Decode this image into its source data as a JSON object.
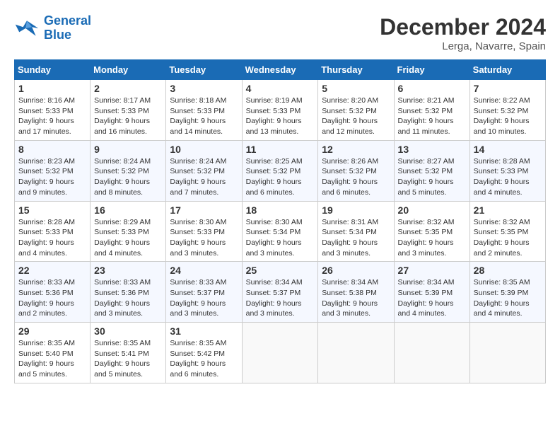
{
  "header": {
    "logo_line1": "General",
    "logo_line2": "Blue",
    "month": "December 2024",
    "location": "Lerga, Navarre, Spain"
  },
  "days_of_week": [
    "Sunday",
    "Monday",
    "Tuesday",
    "Wednesday",
    "Thursday",
    "Friday",
    "Saturday"
  ],
  "weeks": [
    [
      {
        "day": 1,
        "sunrise": "8:16 AM",
        "sunset": "5:33 PM",
        "daylight": "9 hours and 17 minutes."
      },
      {
        "day": 2,
        "sunrise": "8:17 AM",
        "sunset": "5:33 PM",
        "daylight": "9 hours and 16 minutes."
      },
      {
        "day": 3,
        "sunrise": "8:18 AM",
        "sunset": "5:33 PM",
        "daylight": "9 hours and 14 minutes."
      },
      {
        "day": 4,
        "sunrise": "8:19 AM",
        "sunset": "5:33 PM",
        "daylight": "9 hours and 13 minutes."
      },
      {
        "day": 5,
        "sunrise": "8:20 AM",
        "sunset": "5:32 PM",
        "daylight": "9 hours and 12 minutes."
      },
      {
        "day": 6,
        "sunrise": "8:21 AM",
        "sunset": "5:32 PM",
        "daylight": "9 hours and 11 minutes."
      },
      {
        "day": 7,
        "sunrise": "8:22 AM",
        "sunset": "5:32 PM",
        "daylight": "9 hours and 10 minutes."
      }
    ],
    [
      {
        "day": 8,
        "sunrise": "8:23 AM",
        "sunset": "5:32 PM",
        "daylight": "9 hours and 9 minutes."
      },
      {
        "day": 9,
        "sunrise": "8:24 AM",
        "sunset": "5:32 PM",
        "daylight": "9 hours and 8 minutes."
      },
      {
        "day": 10,
        "sunrise": "8:24 AM",
        "sunset": "5:32 PM",
        "daylight": "9 hours and 7 minutes."
      },
      {
        "day": 11,
        "sunrise": "8:25 AM",
        "sunset": "5:32 PM",
        "daylight": "9 hours and 6 minutes."
      },
      {
        "day": 12,
        "sunrise": "8:26 AM",
        "sunset": "5:32 PM",
        "daylight": "9 hours and 6 minutes."
      },
      {
        "day": 13,
        "sunrise": "8:27 AM",
        "sunset": "5:32 PM",
        "daylight": "9 hours and 5 minutes."
      },
      {
        "day": 14,
        "sunrise": "8:28 AM",
        "sunset": "5:33 PM",
        "daylight": "9 hours and 4 minutes."
      }
    ],
    [
      {
        "day": 15,
        "sunrise": "8:28 AM",
        "sunset": "5:33 PM",
        "daylight": "9 hours and 4 minutes."
      },
      {
        "day": 16,
        "sunrise": "8:29 AM",
        "sunset": "5:33 PM",
        "daylight": "9 hours and 4 minutes."
      },
      {
        "day": 17,
        "sunrise": "8:30 AM",
        "sunset": "5:33 PM",
        "daylight": "9 hours and 3 minutes."
      },
      {
        "day": 18,
        "sunrise": "8:30 AM",
        "sunset": "5:34 PM",
        "daylight": "9 hours and 3 minutes."
      },
      {
        "day": 19,
        "sunrise": "8:31 AM",
        "sunset": "5:34 PM",
        "daylight": "9 hours and 3 minutes."
      },
      {
        "day": 20,
        "sunrise": "8:32 AM",
        "sunset": "5:35 PM",
        "daylight": "9 hours and 3 minutes."
      },
      {
        "day": 21,
        "sunrise": "8:32 AM",
        "sunset": "5:35 PM",
        "daylight": "9 hours and 2 minutes."
      }
    ],
    [
      {
        "day": 22,
        "sunrise": "8:33 AM",
        "sunset": "5:36 PM",
        "daylight": "9 hours and 2 minutes."
      },
      {
        "day": 23,
        "sunrise": "8:33 AM",
        "sunset": "5:36 PM",
        "daylight": "9 hours and 3 minutes."
      },
      {
        "day": 24,
        "sunrise": "8:33 AM",
        "sunset": "5:37 PM",
        "daylight": "9 hours and 3 minutes."
      },
      {
        "day": 25,
        "sunrise": "8:34 AM",
        "sunset": "5:37 PM",
        "daylight": "9 hours and 3 minutes."
      },
      {
        "day": 26,
        "sunrise": "8:34 AM",
        "sunset": "5:38 PM",
        "daylight": "9 hours and 3 minutes."
      },
      {
        "day": 27,
        "sunrise": "8:34 AM",
        "sunset": "5:39 PM",
        "daylight": "9 hours and 4 minutes."
      },
      {
        "day": 28,
        "sunrise": "8:35 AM",
        "sunset": "5:39 PM",
        "daylight": "9 hours and 4 minutes."
      }
    ],
    [
      {
        "day": 29,
        "sunrise": "8:35 AM",
        "sunset": "5:40 PM",
        "daylight": "9 hours and 5 minutes."
      },
      {
        "day": 30,
        "sunrise": "8:35 AM",
        "sunset": "5:41 PM",
        "daylight": "9 hours and 5 minutes."
      },
      {
        "day": 31,
        "sunrise": "8:35 AM",
        "sunset": "5:42 PM",
        "daylight": "9 hours and 6 minutes."
      },
      null,
      null,
      null,
      null
    ]
  ]
}
